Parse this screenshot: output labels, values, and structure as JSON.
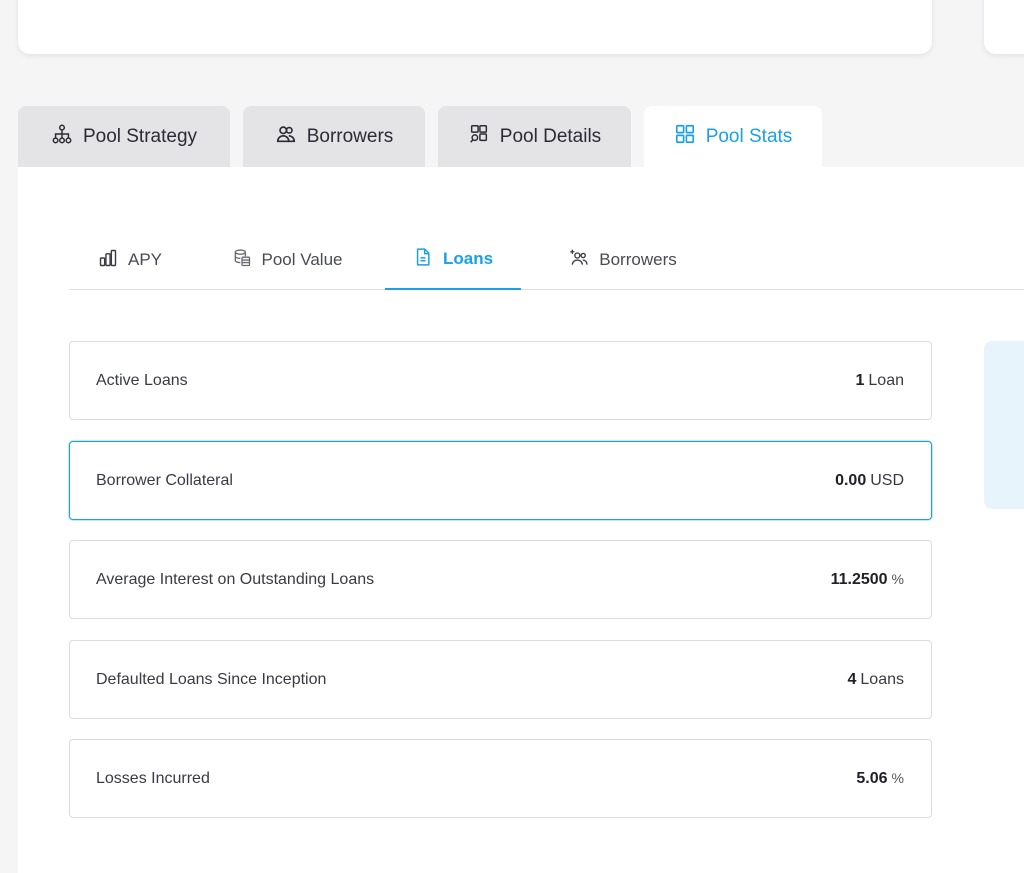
{
  "main_tabs": [
    {
      "label": "Pool Strategy",
      "icon": "hierarchy-icon"
    },
    {
      "label": "Borrowers",
      "icon": "users-icon"
    },
    {
      "label": "Pool Details",
      "icon": "details-search-icon"
    },
    {
      "label": "Pool Stats",
      "icon": "grid-icon",
      "active": true
    }
  ],
  "sub_tabs": [
    {
      "label": "APY",
      "icon": "bar-chart-icon"
    },
    {
      "label": "Pool Value",
      "icon": "coins-icon"
    },
    {
      "label": "Loans",
      "icon": "document-icon",
      "active": true
    },
    {
      "label": "Borrowers",
      "icon": "add-users-icon"
    }
  ],
  "stats": [
    {
      "label": "Active Loans",
      "value": "1",
      "unit": "Loan"
    },
    {
      "label": "Borrower Collateral",
      "value": "0.00",
      "unit": "USD"
    },
    {
      "label": "Average Interest on Outstanding Loans",
      "value": "11.2500",
      "unit": "%"
    },
    {
      "label": "Defaulted Loans Since Inception",
      "value": "4",
      "unit": "Loans"
    },
    {
      "label": "Losses Incurred",
      "value": "5.06",
      "unit": "%"
    }
  ],
  "colors": {
    "accent": "#1aa1e5",
    "tab_inactive_bg": "#e4e4e6",
    "page_bg": "#f5f5f6"
  }
}
